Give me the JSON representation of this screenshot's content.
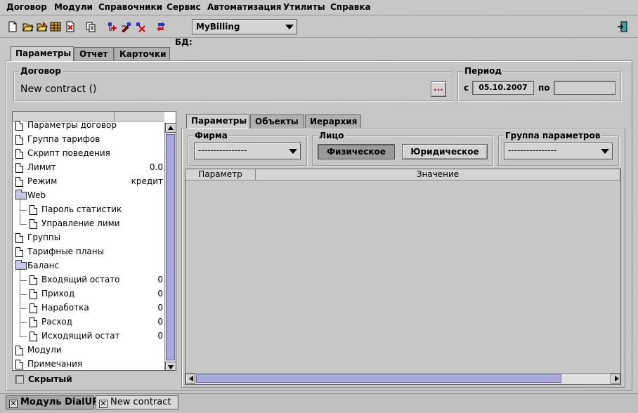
{
  "menu": {
    "items": [
      "Договор",
      "Модули",
      "Справочники",
      "Сервис",
      "Автоматизация",
      "Утилиты",
      "Справка"
    ]
  },
  "toolbar": {
    "db_label": "БД:",
    "db_value": "MyBilling",
    "icons": [
      "new-document-icon",
      "open-folder-icon",
      "open-folder-icon",
      "table-icon",
      "delete-document-icon",
      "copy-icon",
      "add-link-icon",
      "edit-link-icon",
      "remove-link-icon",
      "refresh-icon",
      "exit-icon"
    ]
  },
  "main_tabs": [
    "Параметры",
    "Отчет",
    "Карточки"
  ],
  "contract": {
    "group_title": "Договор",
    "name": "New contract ()",
    "browse_label": "..."
  },
  "period": {
    "group_title": "Период",
    "from_label": "с",
    "from_value": "05.10.2007",
    "to_label": "по",
    "to_value": ""
  },
  "tree": {
    "items": [
      {
        "label": "Параметры договор",
        "value": "",
        "icon": "document-icon",
        "level": 0
      },
      {
        "label": "Группа тарифов",
        "value": "",
        "icon": "document-icon",
        "level": 0
      },
      {
        "label": "Скрипт поведения",
        "value": "",
        "icon": "document-icon",
        "level": 0
      },
      {
        "label": "Лимит",
        "value": "0.0",
        "icon": "document-icon",
        "level": 0
      },
      {
        "label": "Режим",
        "value": "кредит",
        "icon": "document-icon",
        "level": 0
      },
      {
        "label": "Web",
        "value": "",
        "icon": "folder-icon",
        "level": 0
      },
      {
        "label": "Пароль статистик",
        "value": "",
        "icon": "document-icon",
        "level": 1
      },
      {
        "label": "Управление лими",
        "value": "",
        "icon": "document-icon",
        "level": 1
      },
      {
        "label": "Группы",
        "value": "",
        "icon": "document-icon",
        "level": 0
      },
      {
        "label": "Тарифные планы",
        "value": "",
        "icon": "document-icon",
        "level": 0
      },
      {
        "label": "Баланс",
        "value": "",
        "icon": "folder-icon",
        "level": 0
      },
      {
        "label": "Входящий остато",
        "value": "0",
        "icon": "document-icon",
        "level": 1
      },
      {
        "label": "Приход",
        "value": "0",
        "icon": "document-icon",
        "level": 1
      },
      {
        "label": "Наработка",
        "value": "0",
        "icon": "document-icon",
        "level": 1
      },
      {
        "label": "Расход",
        "value": "0",
        "icon": "document-icon",
        "level": 1
      },
      {
        "label": "Исходящий остат",
        "value": "0",
        "icon": "document-icon",
        "level": 1
      },
      {
        "label": "Модули",
        "value": "",
        "icon": "document-icon",
        "level": 0
      },
      {
        "label": "Примечания",
        "value": "",
        "icon": "document-icon",
        "level": 0
      }
    ],
    "hidden_checkbox_label": "Скрытый"
  },
  "inner_tabs": [
    "Параметры",
    "Объекты",
    "Иерархия"
  ],
  "firm": {
    "group_title": "Фирма",
    "value": "----------------"
  },
  "person": {
    "group_title": "Лицо",
    "physical_label": "Физическое",
    "legal_label": "Юридическое"
  },
  "param_group": {
    "group_title": "Группа параметров",
    "value": "----------------"
  },
  "table": {
    "columns": [
      "Параметр",
      "Значение"
    ]
  },
  "taskbar": {
    "tabs": [
      "Модуль DialUP",
      "New contract"
    ],
    "close_symbol": "✕"
  }
}
